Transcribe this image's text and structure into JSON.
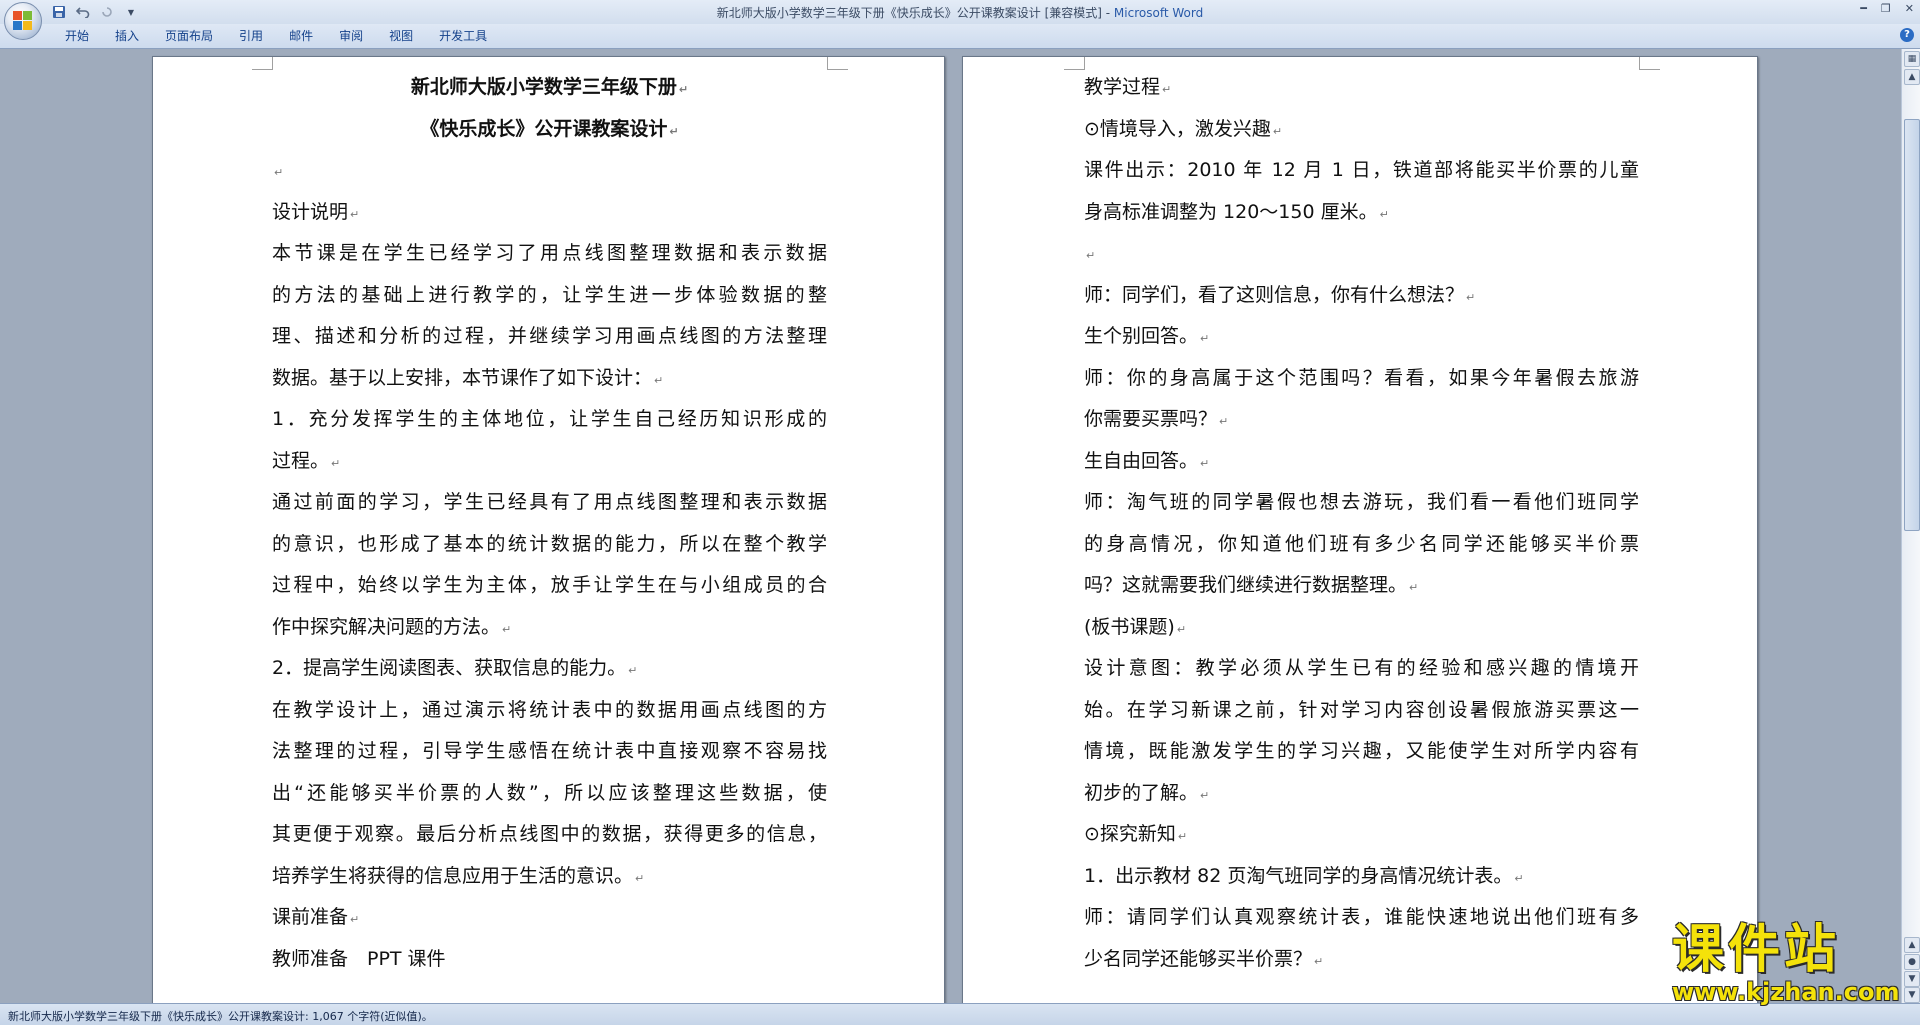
{
  "window": {
    "title_prefix": "新北师大版小学数学三年级下册《快乐成长》公开课教案设计 [兼容模式] - ",
    "app_name": "Microsoft Word"
  },
  "qat": {
    "save_icon": "save-icon",
    "undo_icon": "undo-icon",
    "redo_icon": "redo-icon",
    "customize_icon": "chevron-down-icon"
  },
  "ribbon": {
    "tabs": [
      "开始",
      "插入",
      "页面布局",
      "引用",
      "邮件",
      "审阅",
      "视图",
      "开发工具"
    ]
  },
  "document": {
    "left_page": [
      "新北师大版小学数学三年级下册",
      "《快乐成长》公开课教案设计",
      "",
      "设计说明",
      "本节课是在学生已经学习了用点线图整理数据和表示数据",
      "的方法的基础上进行教学的，让学生进一步体验数据的整",
      "理、描述和分析的过程，并继续学习用画点线图的方法整理",
      "数据。基于以上安排，本节课作了如下设计：",
      "1．充分发挥学生的主体地位，让学生自己经历知识形成的",
      "过程。",
      "通过前面的学习，学生已经具有了用点线图整理和表示数据",
      "的意识，也形成了基本的统计数据的能力，所以在整个教学",
      "过程中，始终以学生为主体，放手让学生在与小组成员的合",
      "作中探究解决问题的方法。",
      "2．提高学生阅读图表、获取信息的能力。",
      "在教学设计上，通过演示将统计表中的数据用画点线图的方",
      "法整理的过程，引导学生感悟在统计表中直接观察不容易找",
      "出“还能够买半价票的人数”，所以应该整理这些数据，使",
      "其更便于观察。最后分析点线图中的数据，获得更多的信息，",
      "培养学生将获得的信息应用于生活的意识。",
      "课前准备",
      "教师准备　PPT 课件"
    ],
    "right_page": [
      "教学过程",
      "⊙情境导入，激发兴趣",
      "课件出示：2010 年 12 月 1 日，铁道部将能买半价票的儿童",
      "身高标准调整为 120～150 厘米。",
      "",
      "师：同学们，看了这则信息，你有什么想法？",
      "生个别回答。",
      "师：你的身高属于这个范围吗？看看，如果今年暑假去旅游",
      "你需要买票吗？",
      "生自由回答。",
      "师：淘气班的同学暑假也想去游玩，我们看一看他们班同学",
      "的身高情况，你知道他们班有多少名同学还能够买半价票",
      "吗？这就需要我们继续进行数据整理。",
      "(板书课题)",
      "设计意图：教学必须从学生已有的经验和感兴趣的情境开",
      "始。在学习新课之前，针对学习内容创设暑假旅游买票这一",
      "情境，既能激发学生的学习兴趣，又能使学生对所学内容有",
      "初步的了解。",
      "⊙探究新知",
      "1．出示教材 82 页淘气班同学的身高情况统计表。",
      "师：请同学们认真观察统计表，谁能快速地说出他们班有多",
      "少名同学还能够买半价票？"
    ],
    "paragraph_mark": "↵"
  },
  "statusbar": {
    "text": "新北师大版小学数学三年级下册《快乐成长》公开课教案设计: 1,067 个字符(近似值)。"
  },
  "watermark": {
    "cn": "课件站",
    "url": "www.kjzhan.com"
  },
  "colors": {
    "ribbon_text": "#15428b",
    "app_name": "#2a5aa8",
    "watermark": "#f4e20a"
  }
}
